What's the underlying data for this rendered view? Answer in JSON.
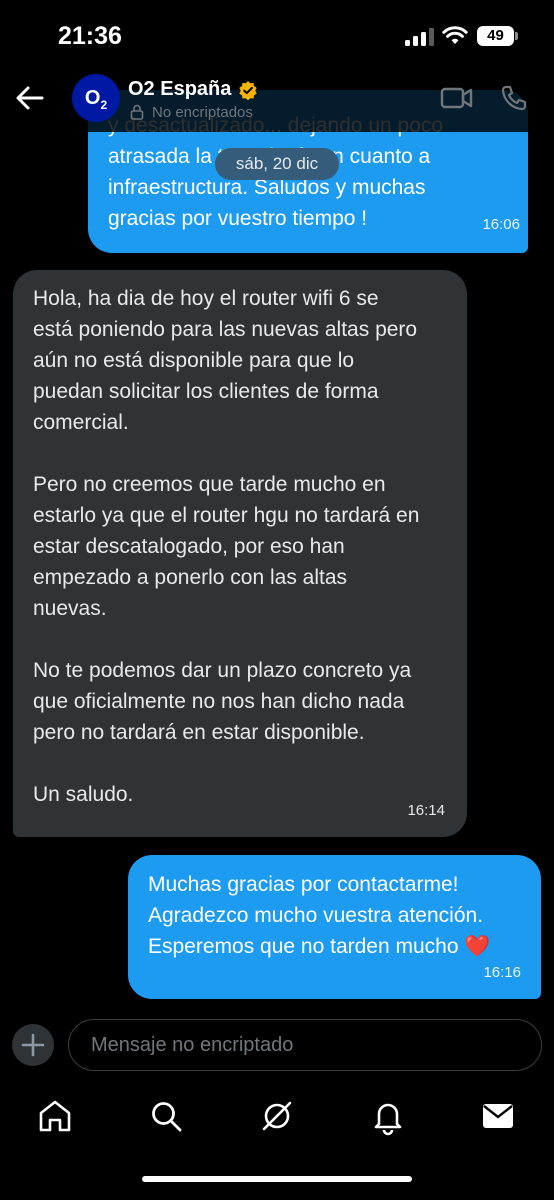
{
  "status_bar": {
    "time": "21:36",
    "battery": "49"
  },
  "header": {
    "title": "O2 España",
    "subtitle": "No encriptados",
    "avatar_text": "O",
    "avatar_subscript": "2",
    "avatar_color": "#0019a5",
    "verified_color": "#f4b400"
  },
  "conversation": {
    "date_divider": "sáb, 20 dic",
    "messages": [
      {
        "direction": "outgoing",
        "text": "y desactualizado... dejando un poco\natrasada la tecnología en cuanto a\ninfraestructura. Saludos y muchas\ngracias por vuestro tiempo !",
        "time": "16:06"
      },
      {
        "direction": "incoming",
        "text": "Hola, ha dia de hoy el router wifi 6 se\nestá poniendo para las nuevas altas pero\naún no está disponible para que lo\npuedan solicitar los clientes de forma\ncomercial.\n\nPero no creemos que tarde mucho en\nestarlo ya que el router hgu no tardará en\nestar descatalogado, por eso han\nempezado a ponerlo con las altas\nnuevas.\n\nNo te podemos dar un plazo concreto ya\nque oficialmente no nos han dicho nada\npero no tardará en estar disponible.\n\nUn saludo.",
        "time": "16:14"
      },
      {
        "direction": "outgoing",
        "text": "Muchas gracias por contactarme!\nAgradezco mucho vuestra atención.\nEsperemos que no tarden mucho",
        "emoji": "❤️",
        "time": "16:16"
      }
    ]
  },
  "composer": {
    "placeholder": "Mensaje no encriptado"
  },
  "tabbar": {
    "tabs": [
      "home-icon",
      "search-icon",
      "grok-icon",
      "notifications-icon",
      "messages-icon"
    ]
  },
  "colors": {
    "accent": "#1d9bf0",
    "incoming_bubble": "#2f3336",
    "background": "#000000"
  }
}
